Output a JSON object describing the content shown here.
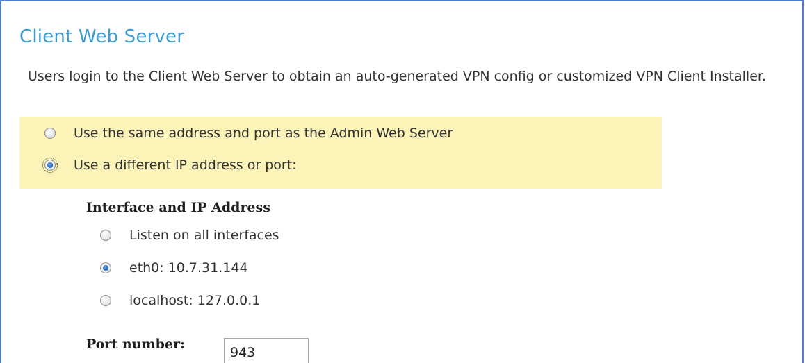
{
  "section": {
    "title": "Client Web Server",
    "description": "Users login to the Client Web Server to obtain an auto-generated VPN config or customized VPN Client Installer."
  },
  "address_mode": {
    "options": [
      {
        "label": "Use the same address and port as the Admin Web Server",
        "checked": false
      },
      {
        "label": "Use a different IP address or port:",
        "checked": true
      }
    ]
  },
  "interface": {
    "heading": "Interface and IP Address",
    "options": [
      {
        "label": "Listen on all interfaces",
        "checked": false
      },
      {
        "label": "eth0: 10.7.31.144",
        "checked": true
      },
      {
        "label": "localhost: 127.0.0.1",
        "checked": false
      }
    ]
  },
  "port": {
    "label": "Port number:",
    "value": "943"
  },
  "colors": {
    "title": "#3f9ccf",
    "highlight": "#fbf3b8",
    "frame_border": "#4f7cc4"
  }
}
